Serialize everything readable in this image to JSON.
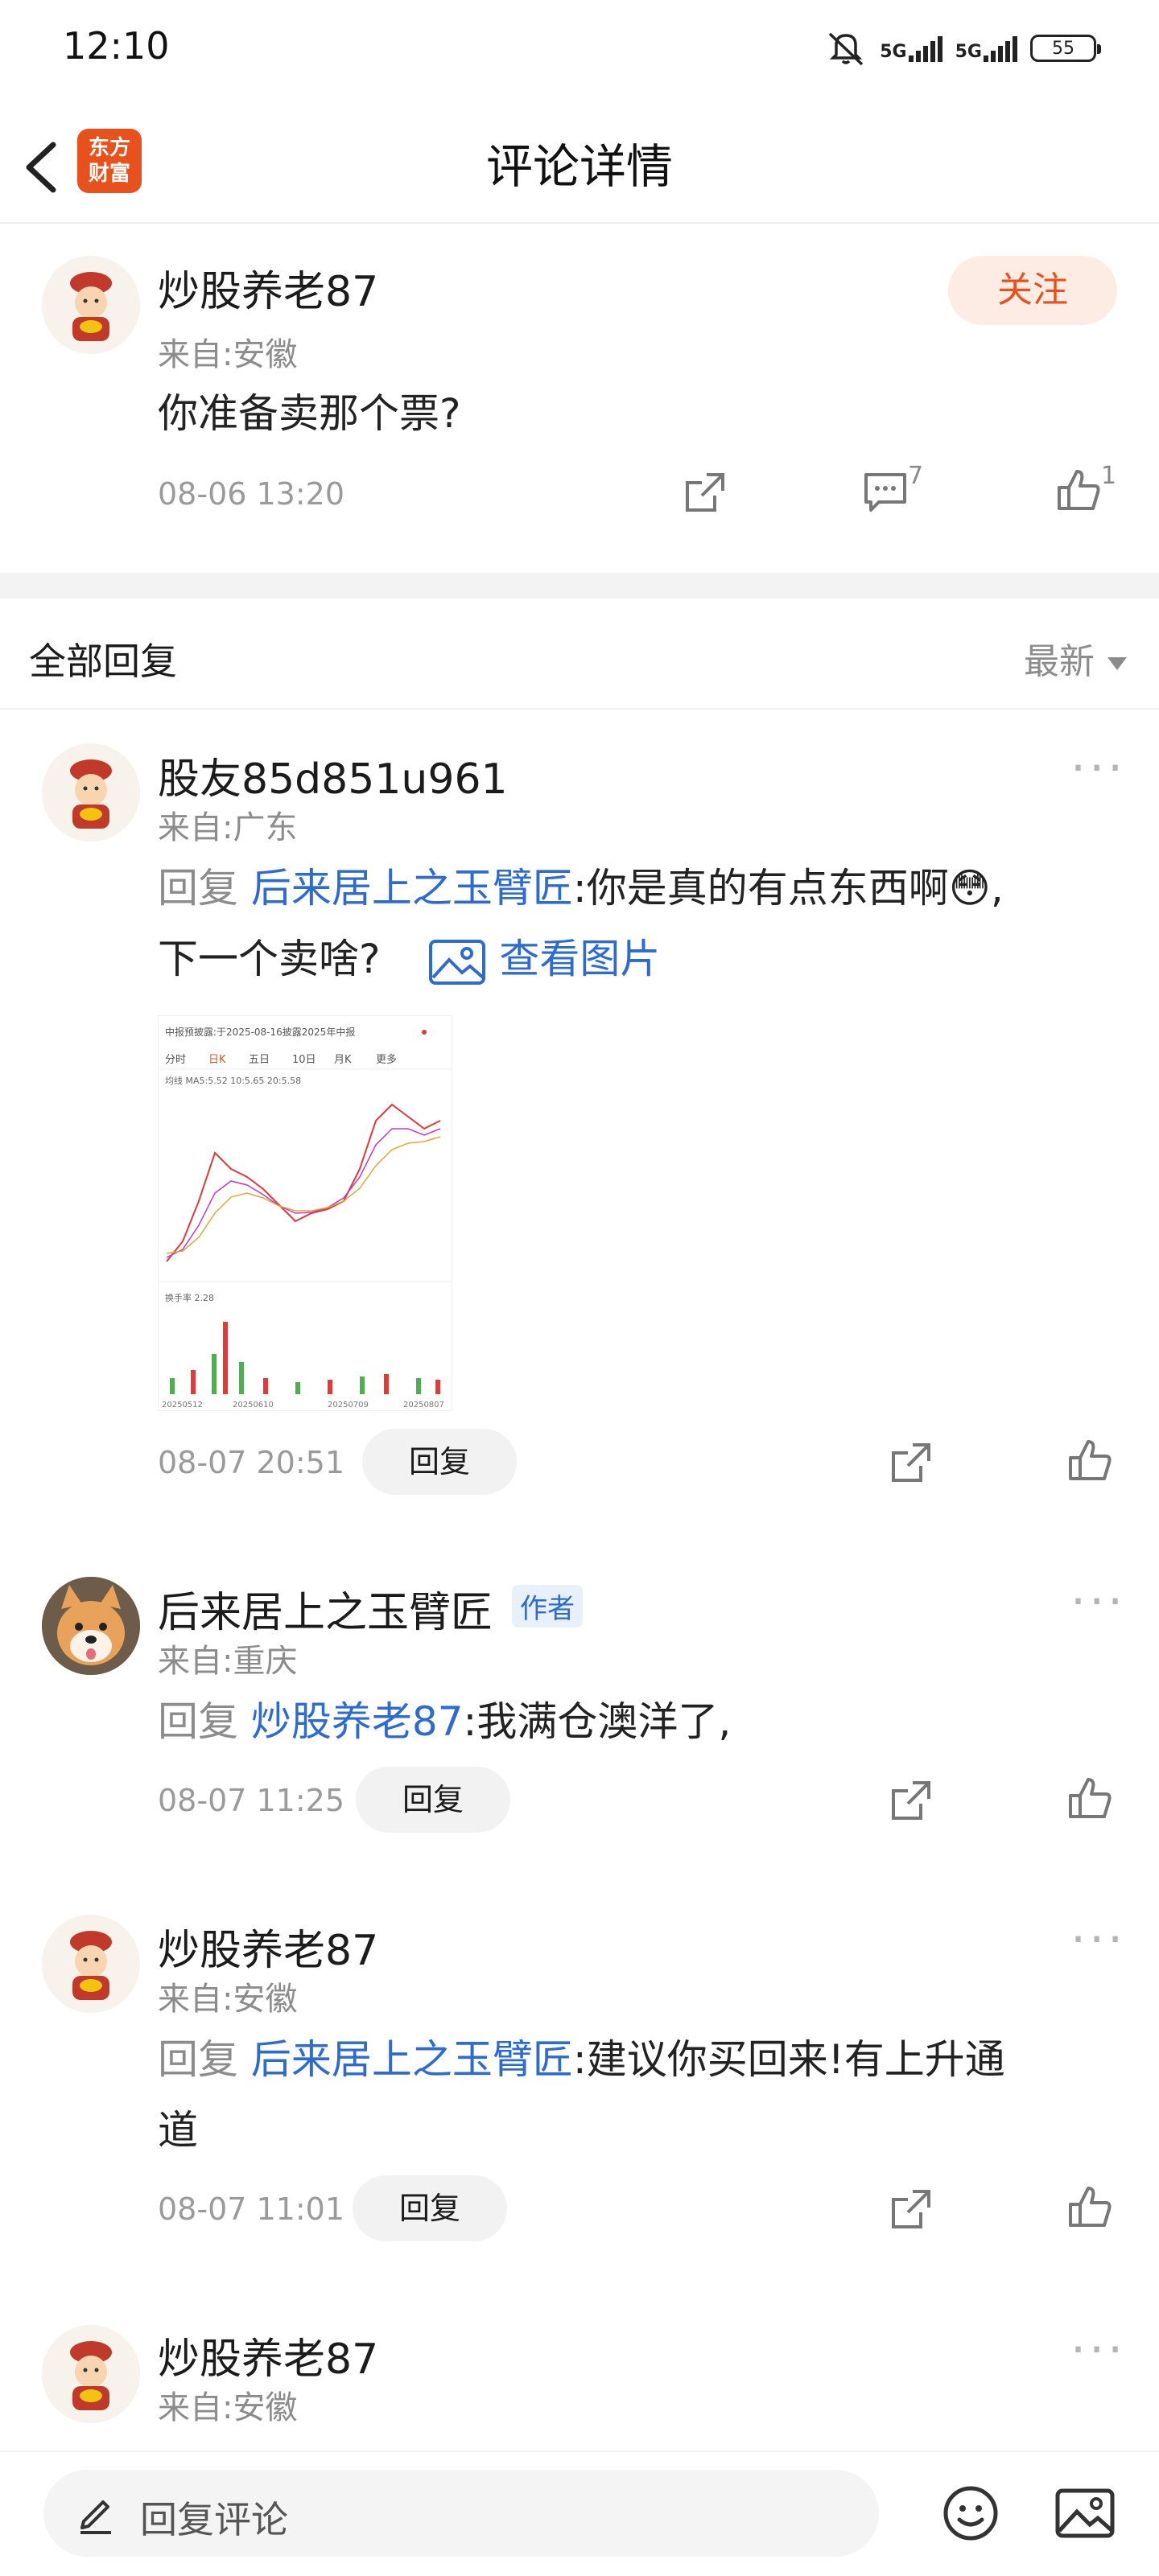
{
  "status": {
    "time": "12:10",
    "sig1": "5G",
    "sig2": "5G",
    "battery": "55"
  },
  "header": {
    "title": "评论详情",
    "logo_top": "东方",
    "logo_bottom": "财富"
  },
  "post": {
    "user": "炒股养老87",
    "from": "来自:安徽",
    "follow": "关注",
    "text": "你准备卖那个票?",
    "time": "08-06 13:20",
    "comment_count": "7",
    "like_count": "1"
  },
  "replies_header": {
    "title": "全部回复",
    "sort": "最新"
  },
  "replies": [
    {
      "user": "股友85d851u961",
      "from": "来自:广东",
      "prefix": "回复",
      "target": "后来居上之玉臂匠",
      "text1": ":你是真的有点东西啊😳,",
      "text2": "下一个卖啥?",
      "view_image": "查看图片",
      "time": "08-07 20:51",
      "reply": "回复"
    },
    {
      "user": "后来居上之玉臂匠",
      "tag": "作者",
      "from": "来自:重庆",
      "prefix": "回复",
      "target": "炒股养老87",
      "text1": ":我满仓澳洋了,",
      "time": "08-07 11:25",
      "reply": "回复"
    },
    {
      "user": "炒股养老87",
      "from": "来自:安徽",
      "prefix": "回复",
      "target": "后来居上之玉臂匠",
      "text1": ":建议你买回来!有上升通",
      "text2": "道",
      "time": "08-07 11:01",
      "reply": "回复"
    },
    {
      "user": "炒股养老87",
      "from": "来自:安徽"
    }
  ],
  "thumb": {
    "title": "中报预披露:于2025-08-16披露2025年中报",
    "tabs": [
      "分时",
      "日K",
      "五日",
      "10日",
      "月K",
      "更多"
    ],
    "ma": "均线  MA5:5.52  10:5.65  20:5.58",
    "dates": [
      "20250512",
      "20250610",
      "20250709",
      "20250807"
    ],
    "turnover": "换手率  2.28"
  },
  "bottom": {
    "placeholder": "回复评论"
  }
}
